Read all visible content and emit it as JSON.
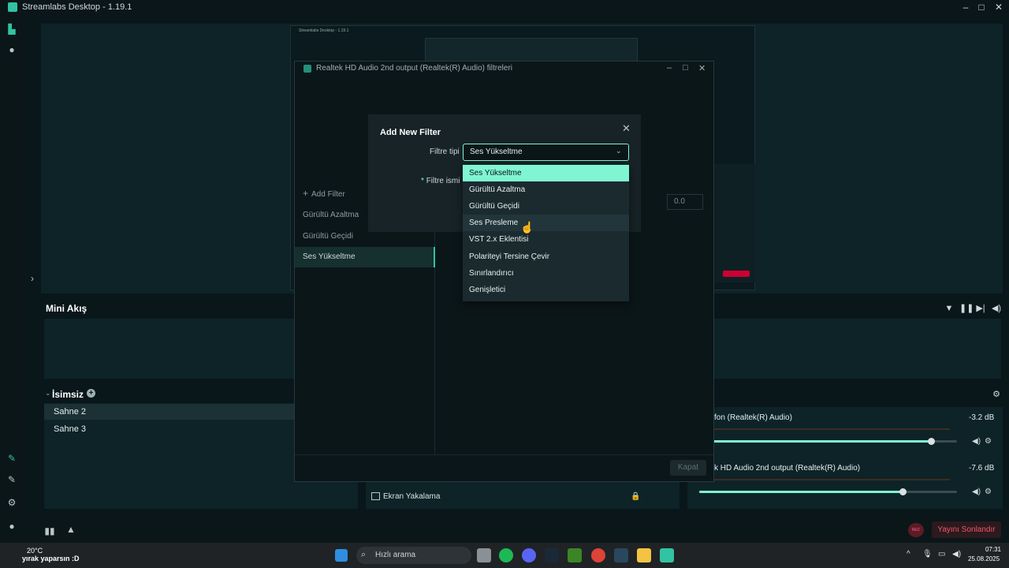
{
  "window": {
    "title": "Streamlabs Desktop - 1.19.1"
  },
  "nested_preview": {
    "title": "Streamlabs Desktop - 1.19.1"
  },
  "mini_akis": {
    "title": "Mini Akış"
  },
  "scenes": {
    "collection": "İsimsiz",
    "items": [
      {
        "label": "Sahne 2",
        "active": true
      },
      {
        "label": "Sahne 3",
        "active": false
      }
    ]
  },
  "sources": {
    "items": [
      {
        "label": "Ekran Yakalama"
      }
    ]
  },
  "mixer": {
    "channels": [
      {
        "name": "fon (Realtek(R) Audio)",
        "db": "-3.2 dB",
        "level": 0.9
      },
      {
        "name": "k HD Audio 2nd output (Realtek(R) Audio)",
        "db": "-7.6 dB",
        "level": 0.79
      }
    ]
  },
  "bottom": {
    "rec_label": "REC",
    "stop_label": "Yayını Sonlandır"
  },
  "filter_window": {
    "title": "Realtek HD Audio 2nd output (Realtek(R) Audio) filtreleri",
    "add_filter": "Add Filter",
    "filters": [
      "Gürültü Azaltma",
      "Gürültü Geçidi",
      "Ses Yükseltme"
    ],
    "selected_filter": "Ses Yükseltme",
    "value": "0.0",
    "close_label": "Kapat"
  },
  "modal": {
    "title": "Add New Filter",
    "type_label": "Filtre tipi",
    "name_label": "Filtre ismi",
    "selected_type": "Ses Yükseltme",
    "options": [
      "Ses Yükseltme",
      "Gürültü Azaltma",
      "Gürültü Geçidi",
      "Ses Presleme",
      "VST 2.x Eklentisi",
      "Polariteyi Tersine Çevir",
      "Sınırlandırıcı",
      "Genişletici"
    ]
  },
  "taskbar": {
    "weather_temp": "20°C",
    "weather_text": "yırak yaparsın :D",
    "search_placeholder": "Hızlı arama",
    "time": "07:31",
    "date": "25.08.2025"
  },
  "colors": {
    "accent": "#80f5d2",
    "brand": "#31c3a2",
    "danger": "#f4566a"
  }
}
